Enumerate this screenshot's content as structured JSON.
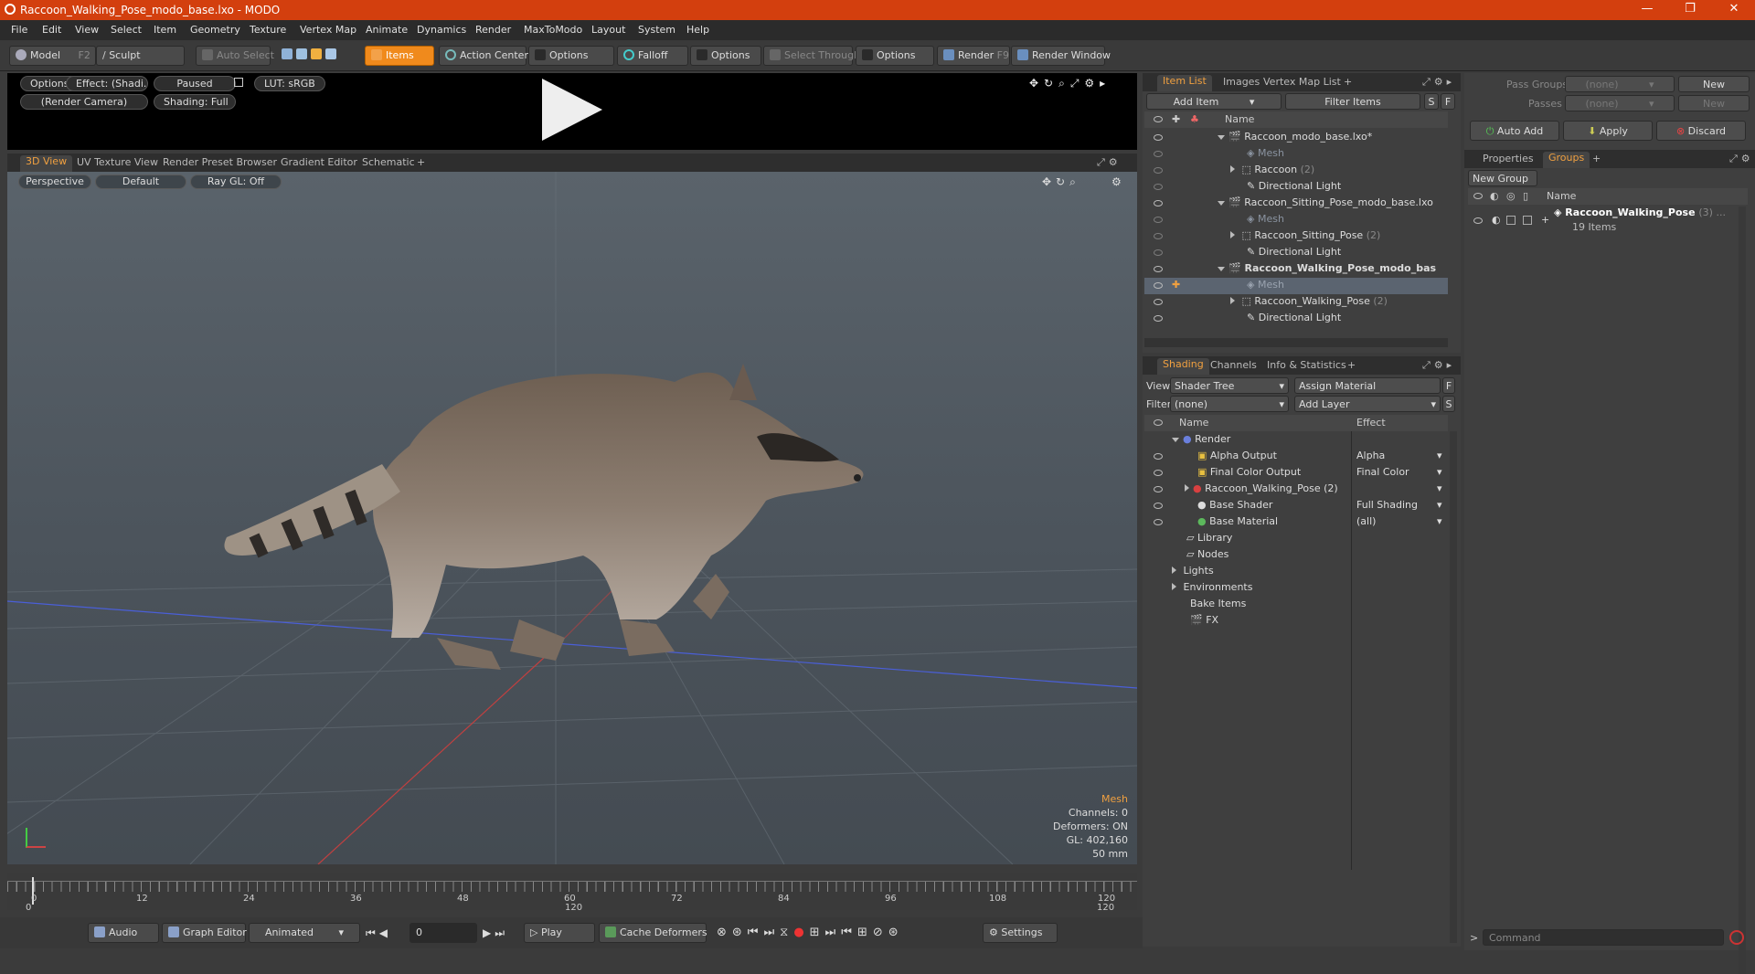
{
  "window": {
    "title": "Raccoon_Walking_Pose_modo_base.lxo - MODO"
  },
  "menu": [
    "File",
    "Edit",
    "View",
    "Select",
    "Item",
    "Geometry",
    "Texture",
    "Vertex Map",
    "Animate",
    "Dynamics",
    "Render",
    "MaxToModo",
    "Layout",
    "System",
    "Help"
  ],
  "toolbar": {
    "model": "Model",
    "model_key": "F2",
    "sculpt": "Sculpt",
    "auto_select": "Auto Select",
    "items": "Items",
    "action_center": "Action Center",
    "options1": "Options",
    "falloff": "Falloff",
    "options2": "Options",
    "select_through": "Select Through",
    "options3": "Options",
    "render": "Render",
    "render_key": "F9",
    "render_window": "Render Window"
  },
  "preview": {
    "options": "Options",
    "effect": "Effect: (Shadi...",
    "paused": "Paused",
    "lut": "LUT: sRGB",
    "camera": "(Render Camera)",
    "shading": "Shading: Full"
  },
  "view_tabs": [
    "3D View",
    "UV Texture View",
    "Render Preset Browser",
    "Gradient Editor",
    "Schematic"
  ],
  "viewport": {
    "projection": "Perspective",
    "style": "Default",
    "raygl": "Ray GL: Off",
    "selection": "Mesh",
    "channels": "Channels: 0",
    "deformers": "Deformers: ON",
    "gl": "GL: 402,160",
    "focal": "50 mm"
  },
  "timeline": {
    "ticks": [
      "0",
      "12",
      "24",
      "36",
      "48",
      "60",
      "72",
      "84",
      "96",
      "108",
      "120"
    ],
    "start": "0",
    "mid": "120",
    "end": "120"
  },
  "transport": {
    "audio": "Audio",
    "graph_editor": "Graph Editor",
    "animated": "Animated",
    "frame": "0",
    "play": "Play",
    "cache": "Cache Deformers",
    "settings": "Settings"
  },
  "itemlist": {
    "tabs": [
      "Item List",
      "Images",
      "Vertex Map List"
    ],
    "add_item": "Add Item",
    "filter": "Filter Items",
    "s": "S",
    "f": "F",
    "col_name": "Name",
    "rows": [
      {
        "label": "Raccoon_modo_base.lxo*",
        "count": "",
        "kind": "scene"
      },
      {
        "label": "Mesh",
        "count": "",
        "kind": "mesh-dim"
      },
      {
        "label": "Raccoon",
        "count": "(2)",
        "kind": "group"
      },
      {
        "label": "Directional Light",
        "count": "",
        "kind": "light"
      },
      {
        "label": "Raccoon_Sitting_Pose_modo_base.lxo",
        "count": "",
        "kind": "scene"
      },
      {
        "label": "Mesh",
        "count": "",
        "kind": "mesh-dim"
      },
      {
        "label": "Raccoon_Sitting_Pose",
        "count": "(2)",
        "kind": "group"
      },
      {
        "label": "Directional Light",
        "count": "",
        "kind": "light"
      },
      {
        "label": "Raccoon_Walking_Pose_modo_bas ...",
        "count": "",
        "kind": "scene-bold"
      },
      {
        "label": "Mesh",
        "count": "",
        "kind": "mesh-sel"
      },
      {
        "label": "Raccoon_Walking_Pose",
        "count": "(2)",
        "kind": "group"
      },
      {
        "label": "Directional Light",
        "count": "",
        "kind": "light"
      }
    ]
  },
  "shading": {
    "tabs": [
      "Shading",
      "Channels",
      "Info & Statistics"
    ],
    "view_label": "View",
    "view_value": "Shader Tree",
    "assign": "Assign Material",
    "filter_label": "Filter",
    "filter_value": "(none)",
    "add_layer": "Add Layer",
    "col_name": "Name",
    "col_effect": "Effect",
    "rows": [
      {
        "label": "Render",
        "effect": ""
      },
      {
        "label": "Alpha Output",
        "effect": "Alpha"
      },
      {
        "label": "Final Color Output",
        "effect": "Final Color"
      },
      {
        "label": "Raccoon_Walking_Pose (2)",
        "effect": ""
      },
      {
        "label": "Base Shader",
        "effect": "Full Shading"
      },
      {
        "label": "Base Material",
        "effect": "(all)"
      },
      {
        "label": "Library",
        "effect": ""
      },
      {
        "label": "Nodes",
        "effect": ""
      },
      {
        "label": "Lights",
        "effect": ""
      },
      {
        "label": "Environments",
        "effect": ""
      },
      {
        "label": "Bake Items",
        "effect": ""
      },
      {
        "label": "FX",
        "effect": ""
      }
    ]
  },
  "groups_panel": {
    "pass_groups": "Pass Groups",
    "passes": "Passes",
    "none1": "(none)",
    "none2": "(none)",
    "new1": "New",
    "new2": "New",
    "auto_add": "Auto Add",
    "apply": "Apply",
    "discard": "Discard",
    "tabs": [
      "Properties",
      "Groups"
    ],
    "new_group": "New Group",
    "col_name": "Name",
    "group_name": "Raccoon_Walking_Pose",
    "group_count": "(3) ...",
    "group_items": "19 Items",
    "command": "Command"
  }
}
